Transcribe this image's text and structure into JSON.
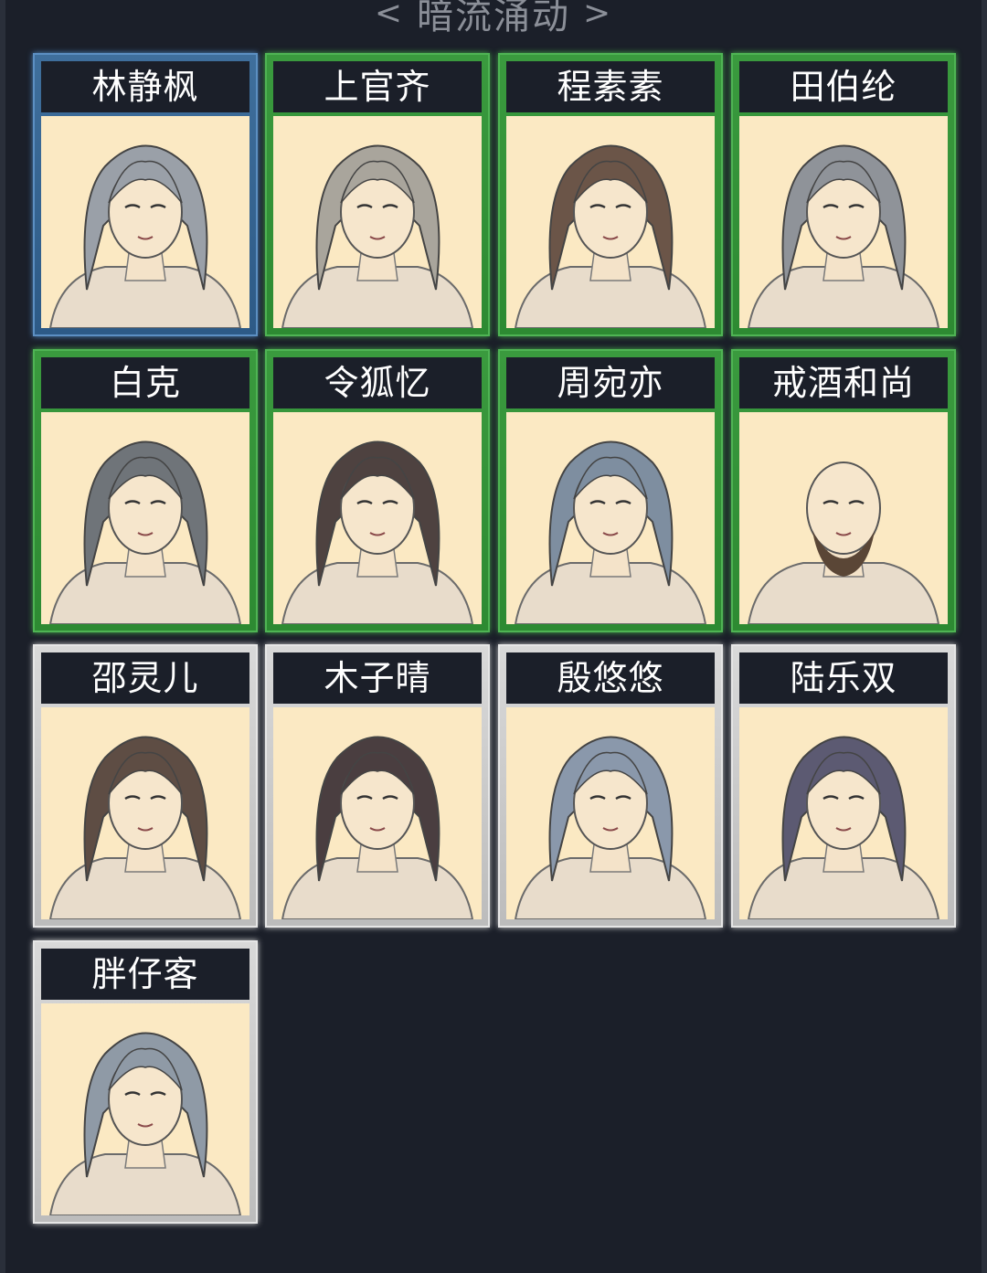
{
  "header": {
    "prev_label": "<",
    "title": "暗流涌动",
    "next_label": ">"
  },
  "colors": {
    "background": "#1b1f29",
    "portrait_bg": "#fbe9c3",
    "rarity_blue": "#4d86bf",
    "rarity_green": "#43a848",
    "rarity_white": "#d9d9d9"
  },
  "characters": [
    {
      "name": "林静枫",
      "rarity": "blue",
      "hair": "#9aa0a8"
    },
    {
      "name": "上官齐",
      "rarity": "green",
      "hair": "#a9a59c"
    },
    {
      "name": "程素素",
      "rarity": "green",
      "hair": "#6b5548"
    },
    {
      "name": "田伯纶",
      "rarity": "green",
      "hair": "#8f9399"
    },
    {
      "name": "白克",
      "rarity": "green",
      "hair": "#6f7479"
    },
    {
      "name": "令狐忆",
      "rarity": "green",
      "hair": "#4e4240"
    },
    {
      "name": "周宛亦",
      "rarity": "green",
      "hair": "#7e8ea0"
    },
    {
      "name": "戒酒和尚",
      "rarity": "green",
      "hair": "#6a5040"
    },
    {
      "name": "邵灵儿",
      "rarity": "white",
      "hair": "#5e4d44"
    },
    {
      "name": "木子晴",
      "rarity": "white",
      "hair": "#4a3e40"
    },
    {
      "name": "殷悠悠",
      "rarity": "white",
      "hair": "#8a98ab"
    },
    {
      "name": "陆乐双",
      "rarity": "white",
      "hair": "#5c5a72"
    },
    {
      "name": "胖仔客",
      "rarity": "white",
      "hair": "#8f9aa6"
    }
  ]
}
